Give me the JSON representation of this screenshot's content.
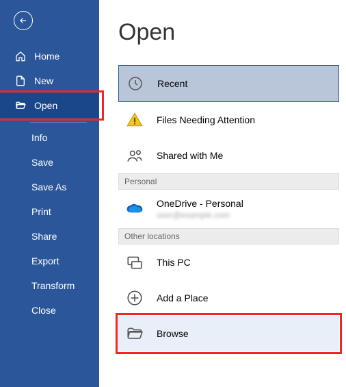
{
  "sidebar": {
    "back_label": "Back",
    "nav": {
      "home": "Home",
      "new": "New",
      "open": "Open"
    },
    "sub": {
      "info": "Info",
      "save": "Save",
      "saveas": "Save As",
      "print": "Print",
      "share": "Share",
      "export": "Export",
      "transform": "Transform",
      "close": "Close"
    }
  },
  "main": {
    "title": "Open",
    "locations": {
      "recent": "Recent",
      "attention": "Files Needing Attention",
      "shared": "Shared with Me",
      "personal_header": "Personal",
      "onedrive": "OneDrive - Personal",
      "onedrive_sub": "user@example.com",
      "other_header": "Other locations",
      "thispc": "This PC",
      "addplace": "Add a Place",
      "browse": "Browse"
    }
  }
}
